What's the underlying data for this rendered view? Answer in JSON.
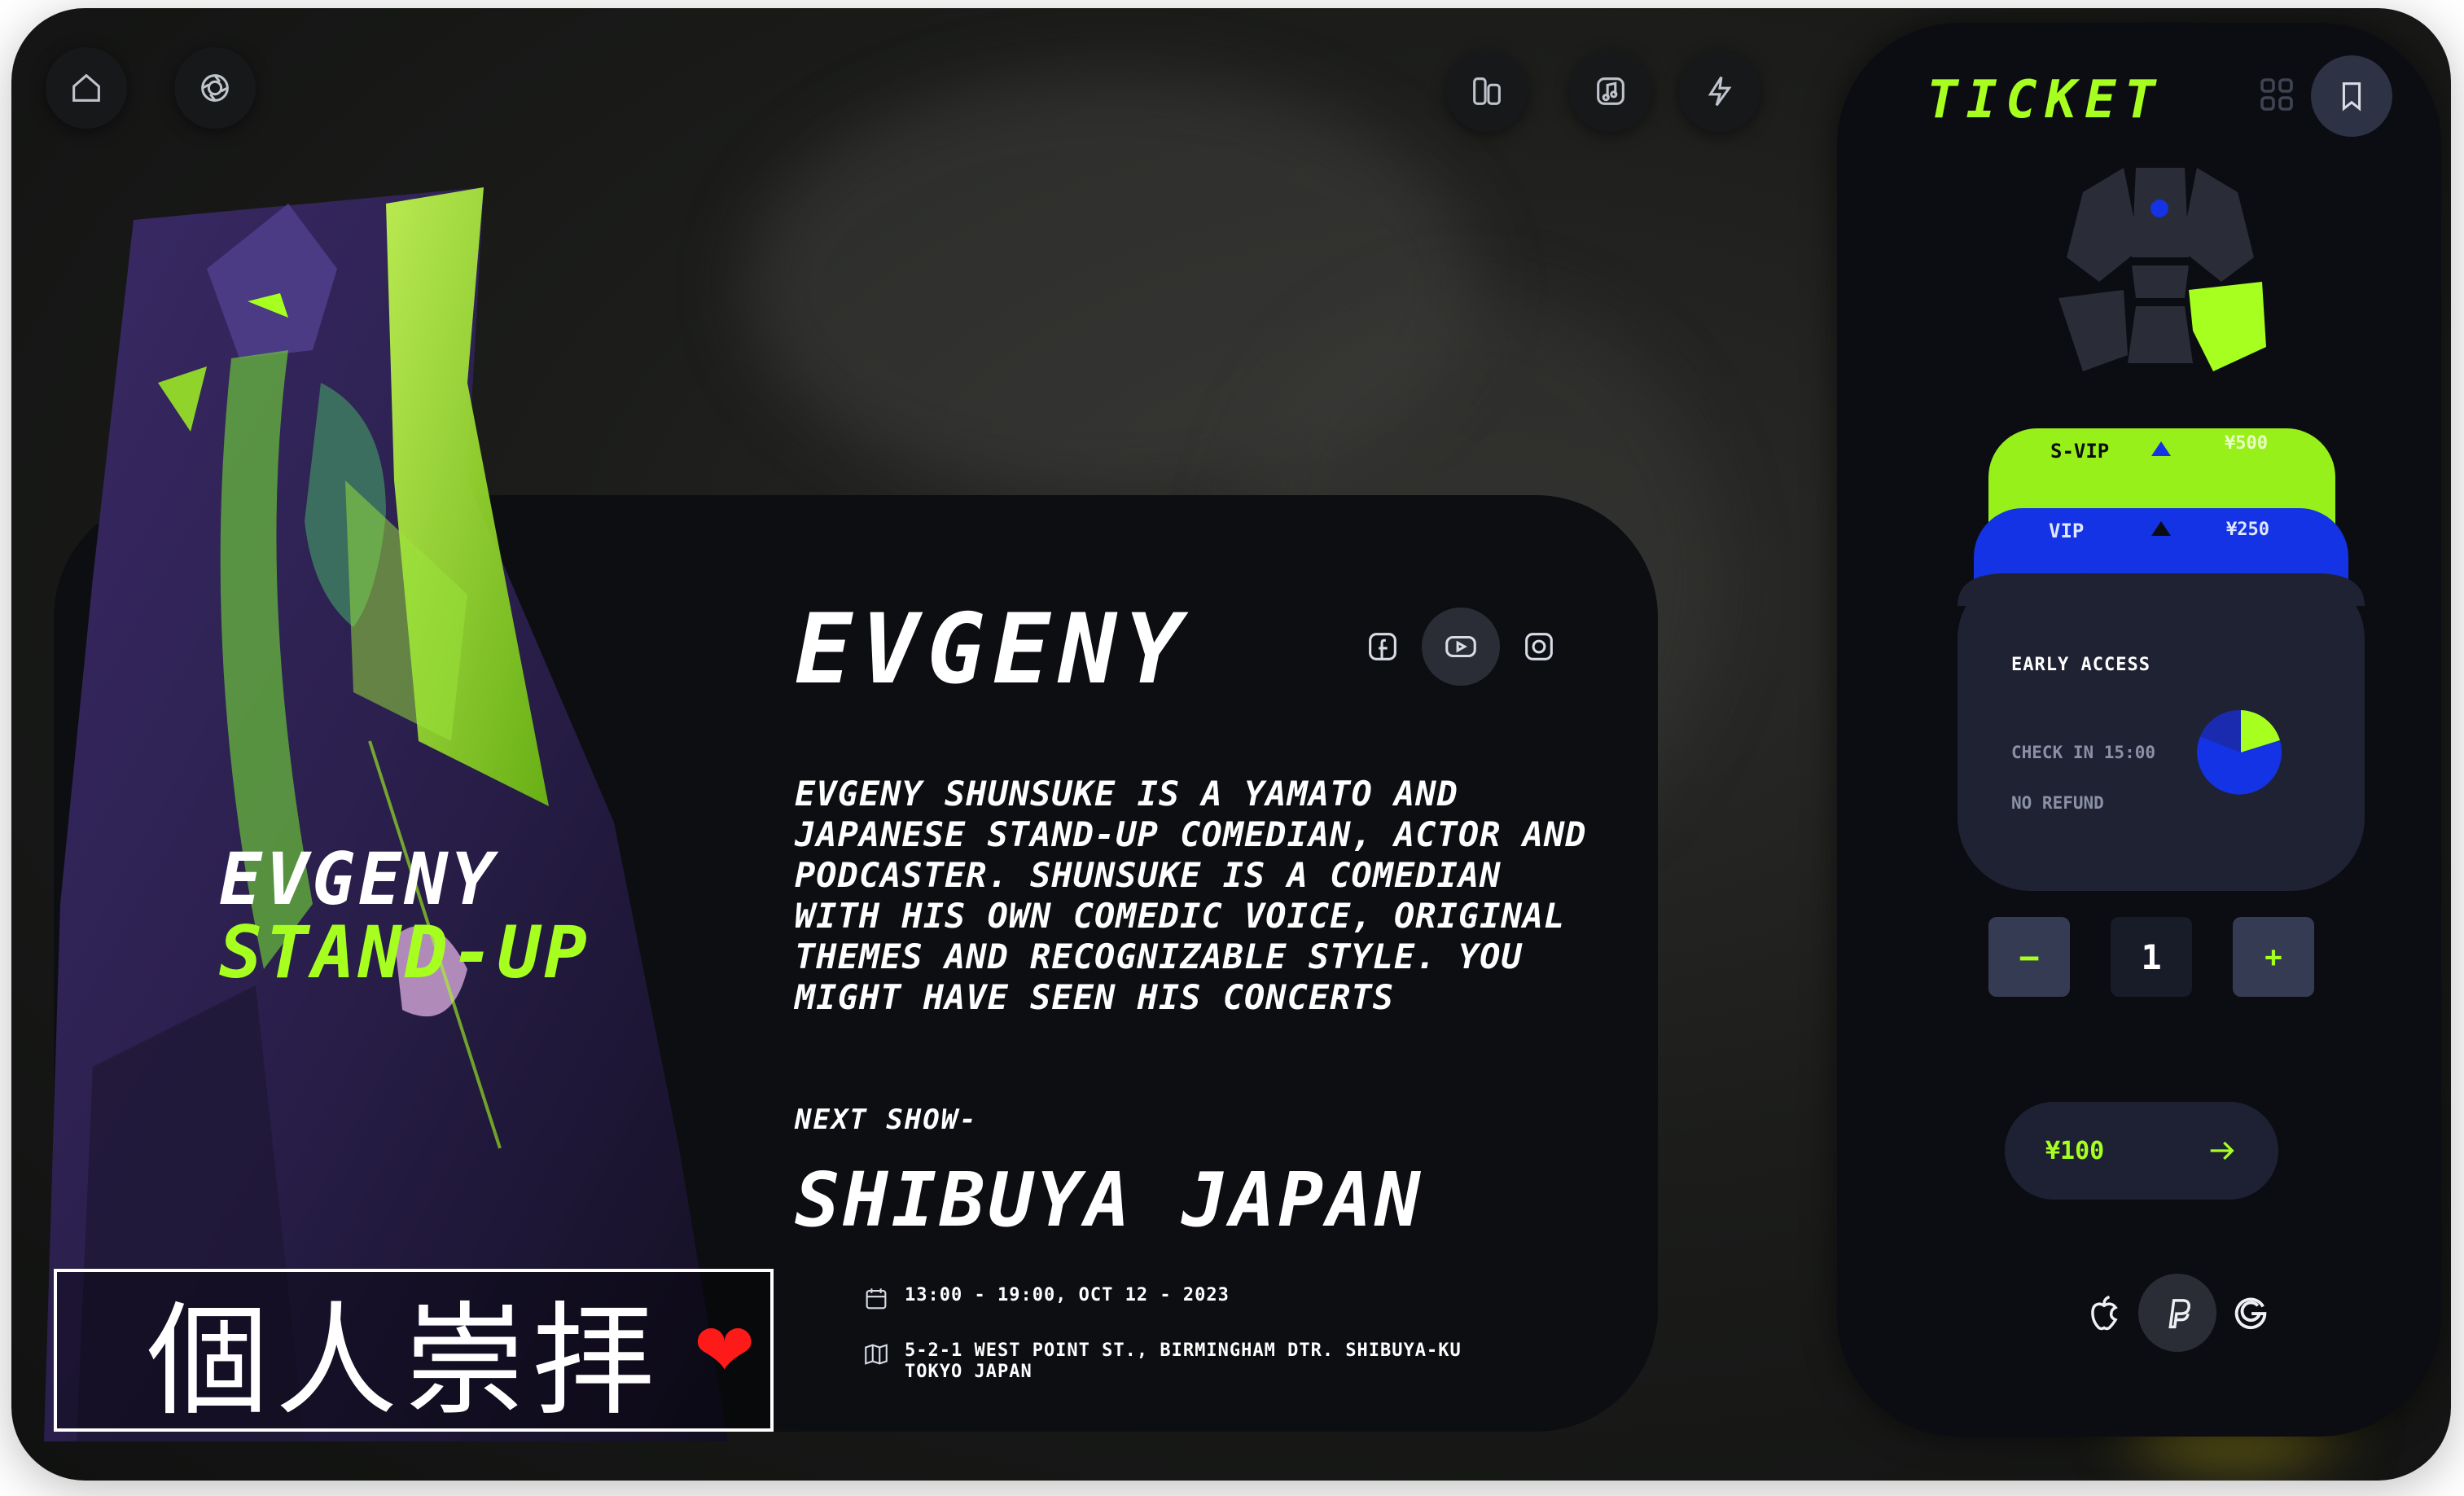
{
  "artist": {
    "name": "EVGENY",
    "art_title_line1": "EVGENY",
    "art_title_line2": "STAND-UP",
    "bio": "Evgeny Shunsuke  is a Yamato and Japanese stand-up comedian, actor and podcaster. Shunsuke is a comedian with his own comedic voice, original themes and recognizable style. You might have seen his concerts",
    "next_show_label": "NEXT SHOW-",
    "venue": "SHIBUYA JAPAN",
    "date_time": "13:00 - 19:00, OCT 12 - 2023",
    "address_line1": "5-2-1 WEST POINT ST., BIRMINGHAM DTR. SHIBUYA-KU",
    "address_line2": "TOKYO JAPAN"
  },
  "social": [
    "facebook-icon",
    "youtube-icon",
    "instagram-icon"
  ],
  "top_nav_icons": [
    "home-icon",
    "camera-icon",
    "files-icon",
    "music-icon",
    "bolt-icon"
  ],
  "watermark": {
    "text": "個人崇拝"
  },
  "ticket": {
    "title": "TICKET",
    "tiers": [
      {
        "name": "S-VIP",
        "price": "¥500",
        "color": "#97f01a"
      },
      {
        "name": "VIP",
        "price": "¥250",
        "color": "#1333e4"
      }
    ],
    "early_access": "EARLY ACCESS",
    "check_in": "CHECK IN 15:00",
    "no_refund": "NO REFUND",
    "quantity": "1",
    "minus_label": "−",
    "plus_label": "+",
    "price": "¥100",
    "payment_icons": [
      "apple-icon",
      "paypal-icon",
      "google-icon"
    ]
  },
  "colors": {
    "accent": "#a6ff1f",
    "blue": "#1333e4",
    "card": "#0d0e12",
    "panel": "#0c0d13"
  }
}
